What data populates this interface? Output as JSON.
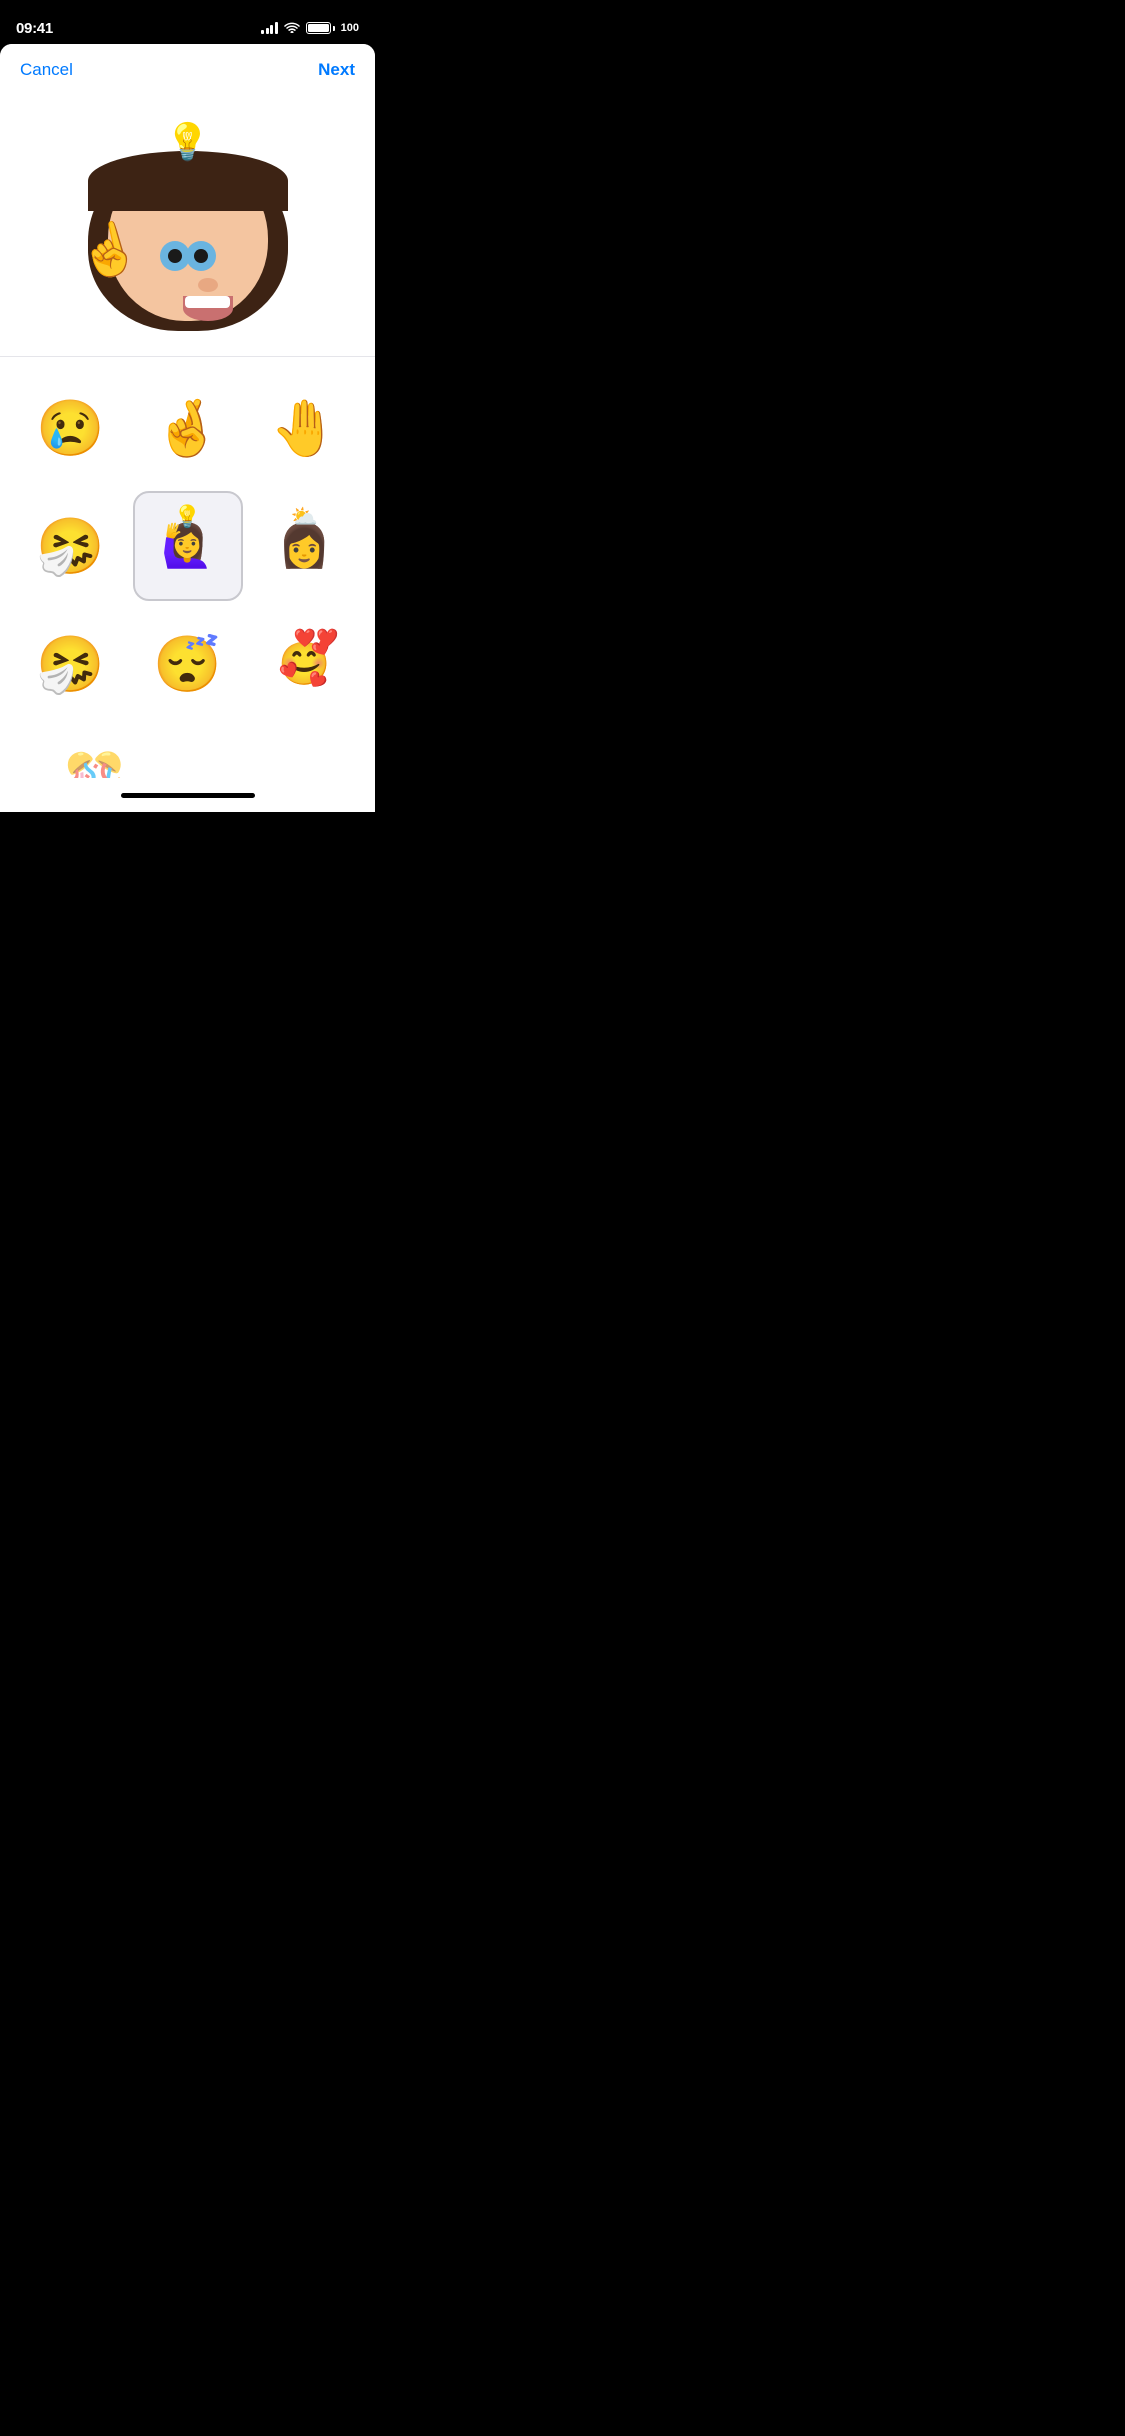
{
  "statusBar": {
    "time": "09:41",
    "batteryLevel": "100",
    "batteryText": "100"
  },
  "navigation": {
    "cancelLabel": "Cancel",
    "nextLabel": "Next"
  },
  "preview": {
    "memoji": "💡🙋‍♀️"
  },
  "stickers": [
    {
      "id": 1,
      "emoji": "😢",
      "overlay": "",
      "description": "crying memoji",
      "selected": false
    },
    {
      "id": 2,
      "emoji": "🤞",
      "overlay": "",
      "description": "fingers crossed memoji",
      "selected": false
    },
    {
      "id": 3,
      "emoji": "🤚",
      "overlay": "",
      "description": "stop hand memoji",
      "selected": false
    },
    {
      "id": 4,
      "emoji": "🤧",
      "overlay": "",
      "description": "sneezing memoji",
      "selected": false
    },
    {
      "id": 5,
      "emoji": "💡",
      "overlay": "💡",
      "description": "lightbulb idea memoji",
      "selected": true
    },
    {
      "id": 6,
      "emoji": "⛅",
      "overlay": "☁️",
      "description": "cloud memoji",
      "selected": false
    },
    {
      "id": 7,
      "emoji": "🤧",
      "overlay": "",
      "description": "blowing nose memoji",
      "selected": false
    },
    {
      "id": 8,
      "emoji": "😴",
      "overlay": "",
      "description": "sleeping memoji",
      "selected": false
    },
    {
      "id": 9,
      "emoji": "🥰",
      "overlay": "❤️",
      "description": "love memoji",
      "selected": false
    },
    {
      "id": 10,
      "emoji": "🎉",
      "overlay": "",
      "description": "party memoji partial",
      "selected": false
    }
  ],
  "homeIndicator": {
    "visible": true
  }
}
